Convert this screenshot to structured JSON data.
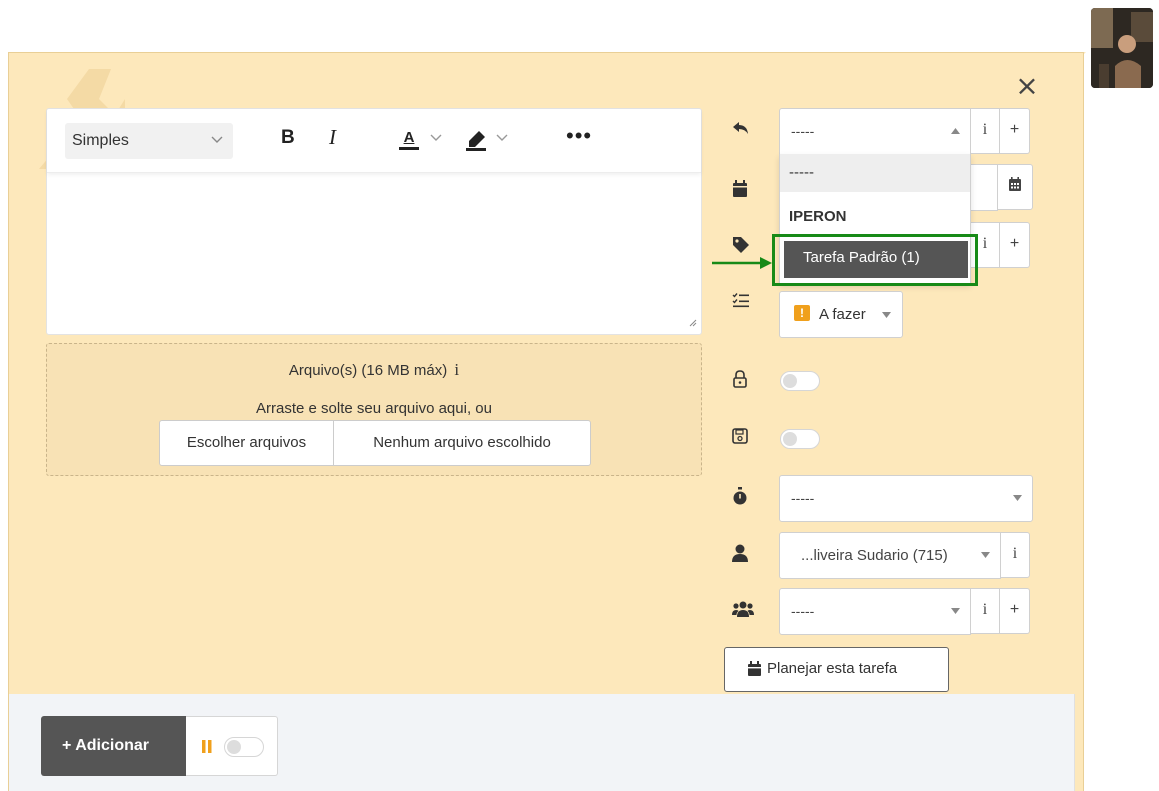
{
  "editor": {
    "format_select": "Simples",
    "bold_label": "B",
    "italic_label": "I",
    "font_color_label": "A",
    "more_label": "•••"
  },
  "attachments": {
    "title": "Arquivo(s) (16 MB máx)",
    "info_glyph": "i",
    "drag_text": "Arraste e solte seu arquivo aqui, ou",
    "choose_button": "Escolher arquivos",
    "no_file_text": "Nenhum arquivo escolhido"
  },
  "fields": {
    "origin_select": "-----",
    "timer_select": "-----",
    "responsible_select": "...liveira Sudario (715)",
    "team_select": "-----",
    "status_label": "A fazer",
    "status_badge": "!",
    "info_glyph": "i",
    "plus_glyph": "+"
  },
  "dropdown": {
    "empty_option": "-----",
    "group_label": "IPERON",
    "selected_option": "Tarefa Padrão (1)"
  },
  "buttons": {
    "close": "×",
    "plan_task": "Planejar esta tarefa",
    "add": "+ Adicionar"
  },
  "colors": {
    "panel_bg": "#fde8bb",
    "highlight_border": "#178a17",
    "status_badge": "#f0a01c",
    "pause_icon": "#f0a01c"
  }
}
